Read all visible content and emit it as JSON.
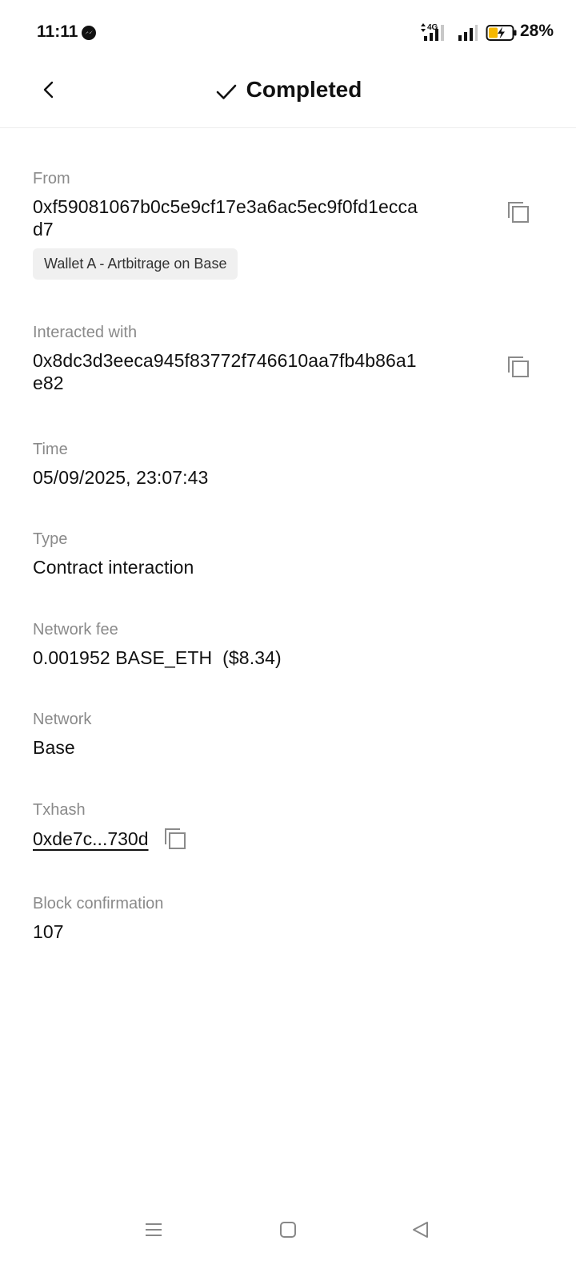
{
  "status_bar": {
    "time": "11:11",
    "network_type": "4G",
    "battery": "28%",
    "icons": [
      "messenger-icon",
      "mobile-data-signal-icon",
      "signal-icon",
      "battery-charging-icon"
    ],
    "battery_color": "#f5b800"
  },
  "header": {
    "title": "Completed",
    "icons": [
      "back-arrow-icon",
      "check-icon"
    ]
  },
  "details": {
    "from": {
      "label": "From",
      "address": "0xf59081067b0c5e9cf17e3a6ac5ec9f0fd1eccad7",
      "wallet_tag": "Wallet A - Artbitrage on Base"
    },
    "interacted_with": {
      "label": "Interacted with",
      "address": "0x8dc3d3eeca945f83772f746610aa7fb4b86a1e82"
    },
    "time": {
      "label": "Time",
      "value": "05/09/2025, 23:07:43"
    },
    "type": {
      "label": "Type",
      "value": "Contract interaction"
    },
    "network_fee": {
      "label": "Network fee",
      "value": "0.001952 BASE_ETH  ($8.34)"
    },
    "network": {
      "label": "Network",
      "value": "Base"
    },
    "txhash": {
      "label": "Txhash",
      "value": "0xde7c...730d"
    },
    "block_confirmation": {
      "label": "Block confirmation",
      "value": "107"
    }
  },
  "nav_bar": {
    "icons": [
      "menu-icon",
      "home-icon",
      "back-triangle-icon"
    ]
  }
}
